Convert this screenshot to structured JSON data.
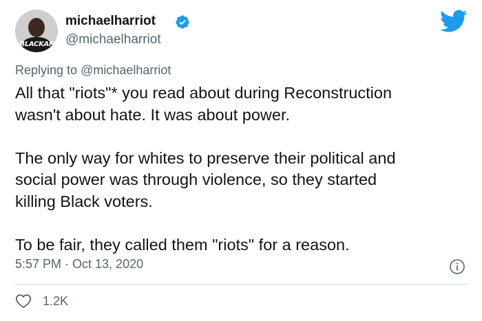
{
  "author": {
    "display_name": "michaelharriot",
    "handle": "@michaelharriot",
    "verified": true,
    "avatar_badge": "BLACKAF"
  },
  "reply": {
    "prefix": "Replying to ",
    "mention": "@michaelharriot"
  },
  "tweet": {
    "paragraph_1_line_1": "All that \"riots\"* you read about during Reconstruction",
    "paragraph_1_line_2": "wasn't about hate. It was about power.",
    "paragraph_2_line_1": "The only way for whites to preserve their political and",
    "paragraph_2_line_2": "social power was through violence, so they started",
    "paragraph_2_line_3": "killing Black voters.",
    "paragraph_3_line_1": "To be fair, they called them \"riots\" for a reason."
  },
  "meta": {
    "timestamp": "5:57 PM · Oct 13, 2020"
  },
  "engagement": {
    "likes": "1.2K"
  },
  "icons": {
    "brand": "twitter-bird-icon",
    "verified": "verified-badge-icon",
    "info": "info-icon",
    "like": "heart-icon"
  },
  "colors": {
    "twitter_blue": "#1d9bf0",
    "text_primary": "#0f1419",
    "text_secondary": "#536471",
    "divider": "#cfd9de"
  }
}
